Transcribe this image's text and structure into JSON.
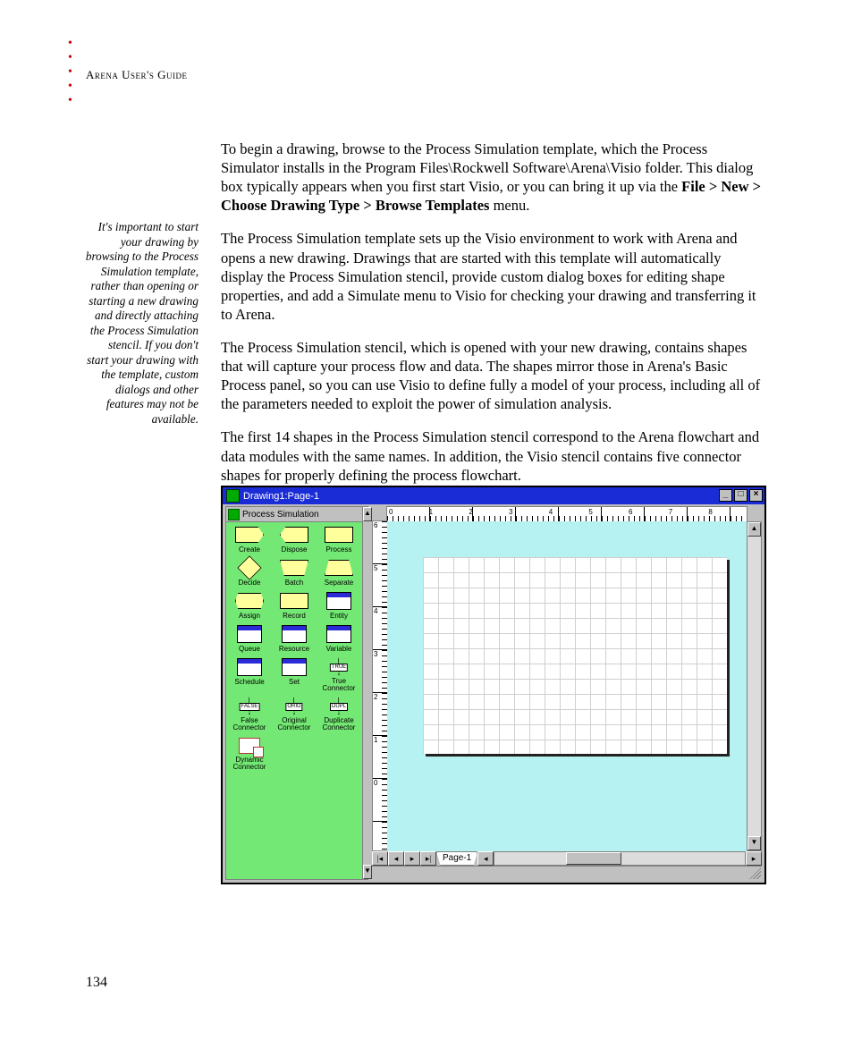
{
  "header": {
    "running_head": "Arena User's Guide"
  },
  "page_number": "134",
  "margin_note": "It's important to start your drawing by browsing to the Process Simulation template, rather than opening or starting a new drawing and directly attaching the Process Simulation stencil. If you don't start your drawing with the template, custom dialogs and other features may not be available.",
  "paragraphs": {
    "p1a": "To begin a drawing, browse to the Process Simulation template, which the Process Simulator installs in the Program Files\\Rockwell Software\\Arena\\Visio folder. This dialog box typically appears when you first start Visio, or you can bring it up via the ",
    "p1b_bold": "File > New > Choose Drawing Type > Browse Templates",
    "p1c": " menu.",
    "p2": "The Process Simulation template sets up the Visio environment to work with Arena and opens a new drawing. Drawings that are started with this template will automatically display the Process Simulation stencil, provide custom dialog boxes for editing shape properties, and add a Simulate menu to Visio for checking your drawing and transferring it to Arena.",
    "p3": "The Process Simulation stencil, which is opened with your new drawing, contains shapes that will capture your process flow and data. The shapes mirror those in Arena's Basic Process panel, so you can use Visio to define fully a model of your process, including all of the parameters needed to exploit the power of simulation analysis.",
    "p4": "The first 14 shapes in the Process Simulation stencil correspond to the Arena flowchart and data modules with the same names. In addition, the Visio stencil contains five connector shapes for properly defining the process flowchart."
  },
  "screenshot": {
    "window_title": "Drawing1:Page-1",
    "stencil_title": "Process Simulation",
    "page_tab": "Page-1",
    "ruler_h": [
      "0",
      "1",
      "2",
      "3",
      "4",
      "5",
      "6",
      "7",
      "8"
    ],
    "ruler_v": [
      "6",
      "5",
      "4",
      "3",
      "2",
      "1",
      "0"
    ],
    "conn_tags": {
      "true": "TRUE",
      "false": "FALSE",
      "orig": "ORIG",
      "dupl": "DUPL"
    },
    "shapes": [
      {
        "label": "Create",
        "cls": "sp-create"
      },
      {
        "label": "Dispose",
        "cls": "sp-dispose"
      },
      {
        "label": "Process",
        "cls": "sp-rect"
      },
      {
        "label": "Decide",
        "cls": "sp-diamond"
      },
      {
        "label": "Batch",
        "cls": "sp-trap"
      },
      {
        "label": "Separate",
        "cls": "sp-trap-r"
      },
      {
        "label": "Assign",
        "cls": "sp-oct"
      },
      {
        "label": "Record",
        "cls": "sp-rect"
      },
      {
        "label": "Entity",
        "cls": "sp-sheet"
      },
      {
        "label": "Queue",
        "cls": "sp-sheet"
      },
      {
        "label": "Resource",
        "cls": "sp-sheet"
      },
      {
        "label": "Variable",
        "cls": "sp-sheet"
      },
      {
        "label": "Schedule",
        "cls": "sp-sheet"
      },
      {
        "label": "Set",
        "cls": "sp-sheet"
      },
      {
        "label": "True Connector",
        "cls": "sp-conn",
        "tag": "true"
      },
      {
        "label": "False Connector",
        "cls": "sp-conn",
        "tag": "false"
      },
      {
        "label": "Original Connector",
        "cls": "sp-conn",
        "tag": "orig"
      },
      {
        "label": "Duplicate Connector",
        "cls": "sp-conn",
        "tag": "dupl"
      },
      {
        "label": "Dynamic Connector",
        "cls": "sp-dyn"
      }
    ]
  }
}
